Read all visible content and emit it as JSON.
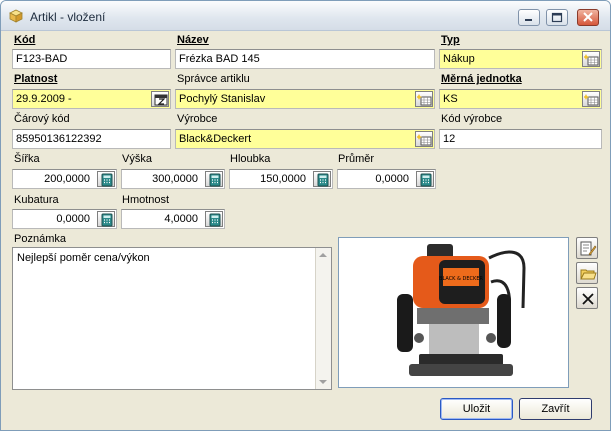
{
  "window": {
    "title": "Artikl - vložení"
  },
  "fields": {
    "kod": {
      "label": "Kód",
      "value": "F123-BAD"
    },
    "nazev": {
      "label": "Název",
      "value": "Frézka BAD 145"
    },
    "typ": {
      "label": "Typ",
      "value": "Nákup"
    },
    "platnost": {
      "label": "Platnost",
      "value": "29.9.2009 -"
    },
    "spravce": {
      "label": "Správce artiklu",
      "value": "Pochylý Stanislav"
    },
    "mj": {
      "label": "Měrná jednotka",
      "value": "KS"
    },
    "carovy_kod": {
      "label": "Čárový kód",
      "value": "85950136122392"
    },
    "vyrobce": {
      "label": "Výrobce",
      "value": "Black&Deckert"
    },
    "kod_vyrobce": {
      "label": "Kód výrobce",
      "value": "12"
    },
    "sirka": {
      "label": "Šířka",
      "value": "200,0000"
    },
    "vyska": {
      "label": "Výška",
      "value": "300,0000"
    },
    "hloubka": {
      "label": "Hloubka",
      "value": "150,0000"
    },
    "prumer": {
      "label": "Průměr",
      "value": "0,0000"
    },
    "kubatura": {
      "label": "Kubatura",
      "value": "0,0000"
    },
    "hmotnost": {
      "label": "Hmotnost",
      "value": "4,0000"
    },
    "poznamka": {
      "label": "Poznámka",
      "value": "Nejlepší poměr cena/výkon"
    }
  },
  "image": {
    "brand_text": "BLACK & DECKER"
  },
  "buttons": {
    "ok": "Uložit",
    "close": "Zavřít"
  },
  "colors": {
    "required_field": "#ffff99",
    "window_bg": "#ece9d8",
    "title_gradient_top": "#fbfcfd"
  },
  "icons": [
    "box-icon",
    "minimize-icon",
    "maximize-icon",
    "close-icon",
    "picker-icon",
    "calendar-icon",
    "calculator-icon",
    "edit-image-icon",
    "open-folder-icon",
    "delete-icon"
  ]
}
